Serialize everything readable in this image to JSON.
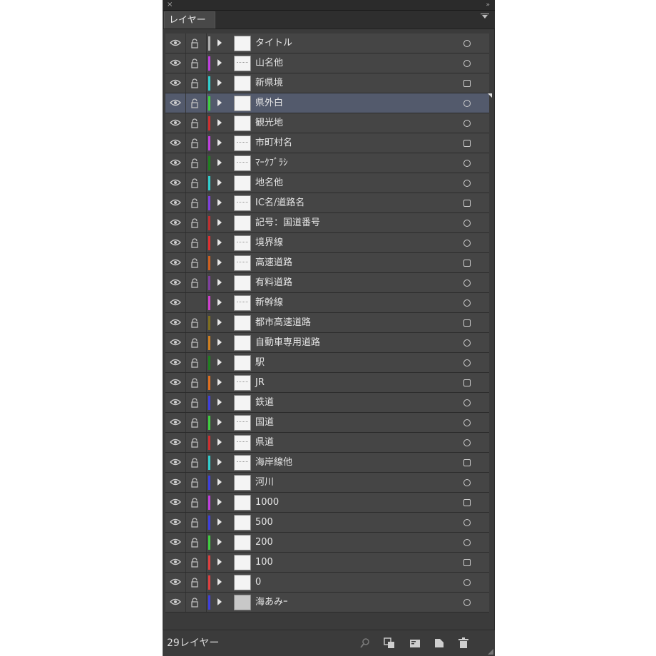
{
  "panel": {
    "close_glyph": "×",
    "collapse_glyph": "»",
    "tab_label": "レイヤー",
    "menu_glyph": "☰"
  },
  "layers": [
    {
      "name": "タイトル",
      "color": "#b0b0b0",
      "lock": true,
      "target": "circle",
      "thumb": "white"
    },
    {
      "name": "山名他",
      "color": "#c040e0",
      "lock": true,
      "target": "circle",
      "thumb": "sketch"
    },
    {
      "name": "新県境",
      "color": "#30d0d0",
      "lock": true,
      "target": "square",
      "thumb": "white"
    },
    {
      "name": "県外白",
      "color": "#40d040",
      "lock": true,
      "target": "circle",
      "thumb": "white",
      "selected": true
    },
    {
      "name": "観光地",
      "color": "#d03030",
      "lock": true,
      "target": "circle",
      "thumb": "white"
    },
    {
      "name": "市町村名",
      "color": "#c040e0",
      "lock": true,
      "target": "square",
      "thumb": "sketch"
    },
    {
      "name": "ﾏｰｸﾌﾞﾗｼ",
      "color": "#208020",
      "lock": true,
      "target": "circle",
      "thumb": "sketch"
    },
    {
      "name": "地名他",
      "color": "#30d0d0",
      "lock": true,
      "target": "circle",
      "thumb": "white"
    },
    {
      "name": "IC名/道路名",
      "color": "#8040e0",
      "lock": true,
      "target": "square",
      "thumb": "sketch"
    },
    {
      "name": "記号：国道番号",
      "color": "#c03030",
      "lock": true,
      "target": "circle",
      "thumb": "white"
    },
    {
      "name": "境界線",
      "color": "#e03030",
      "lock": true,
      "target": "circle",
      "thumb": "sketch"
    },
    {
      "name": "高速道路",
      "color": "#d06020",
      "lock": true,
      "target": "square",
      "thumb": "sketch"
    },
    {
      "name": "有料道路",
      "color": "#8040a0",
      "lock": true,
      "target": "circle",
      "thumb": "white"
    },
    {
      "name": "新幹線",
      "color": "#d040d0",
      "lock": false,
      "target": "circle",
      "thumb": "sketch"
    },
    {
      "name": "都市高速道路",
      "color": "#807020",
      "lock": true,
      "target": "square",
      "thumb": "white"
    },
    {
      "name": "自動車専用道路",
      "color": "#d08020",
      "lock": true,
      "target": "circle",
      "thumb": "white"
    },
    {
      "name": "駅",
      "color": "#208020",
      "lock": true,
      "target": "circle",
      "thumb": "white"
    },
    {
      "name": "JR",
      "color": "#e07020",
      "lock": true,
      "target": "square",
      "thumb": "sketch"
    },
    {
      "name": "鉄道",
      "color": "#4040e0",
      "lock": true,
      "target": "circle",
      "thumb": "white"
    },
    {
      "name": "国道",
      "color": "#40d040",
      "lock": true,
      "target": "circle",
      "thumb": "sketch"
    },
    {
      "name": "県道",
      "color": "#d03030",
      "lock": true,
      "target": "circle",
      "thumb": "sketch"
    },
    {
      "name": "海岸線他",
      "color": "#30d0d0",
      "lock": true,
      "target": "square",
      "thumb": "sketch"
    },
    {
      "name": "河川",
      "color": "#4040e0",
      "lock": true,
      "target": "circle",
      "thumb": "white"
    },
    {
      "name": "1000",
      "color": "#c040e0",
      "lock": true,
      "target": "square",
      "thumb": "white"
    },
    {
      "name": "500",
      "color": "#4040e0",
      "lock": true,
      "target": "circle",
      "thumb": "white"
    },
    {
      "name": "200",
      "color": "#40d040",
      "lock": true,
      "target": "circle",
      "thumb": "white"
    },
    {
      "name": "100",
      "color": "#e04040",
      "lock": true,
      "target": "square",
      "thumb": "white"
    },
    {
      "name": "0",
      "color": "#e04040",
      "lock": true,
      "target": "circle",
      "thumb": "white"
    },
    {
      "name": "海あみｰ",
      "color": "#4040e0",
      "lock": true,
      "target": "circle",
      "thumb": "gray"
    }
  ],
  "footer": {
    "count_label": "29レイヤー"
  }
}
